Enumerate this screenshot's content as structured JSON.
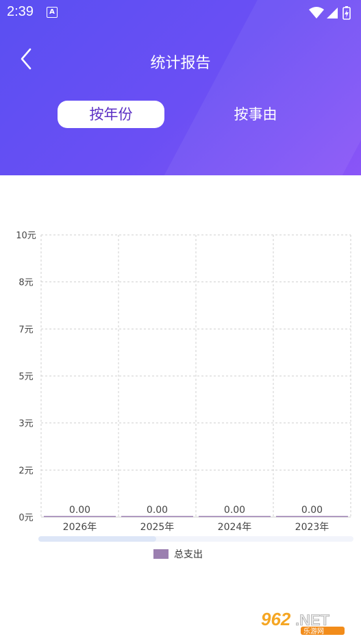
{
  "status": {
    "time": "2:39",
    "a_icon": "A"
  },
  "header": {
    "title": "统计报告"
  },
  "tabs": [
    {
      "label": "按年份",
      "active": true
    },
    {
      "label": "按事由",
      "active": false
    }
  ],
  "colors": {
    "accent": "#6b4ff4",
    "bar": "#9b7fb0"
  },
  "chart_data": {
    "type": "bar",
    "categories": [
      "2026年",
      "2025年",
      "2024年",
      "2023年"
    ],
    "series": [
      {
        "name": "总支出",
        "values": [
          0,
          0,
          0,
          0
        ],
        "labels": [
          "0.00",
          "0.00",
          "0.00",
          "0.00"
        ]
      }
    ],
    "y_ticks": [
      "10元",
      "8元",
      "7元",
      "5元",
      "3元",
      "2元",
      "0元"
    ],
    "ylim": [
      0,
      10
    ],
    "grid": true,
    "legend_placement": "bottom-center"
  },
  "legend": {
    "label": "总支出"
  },
  "watermark": {
    "main": "962.NET",
    "sub": "乐游网"
  }
}
